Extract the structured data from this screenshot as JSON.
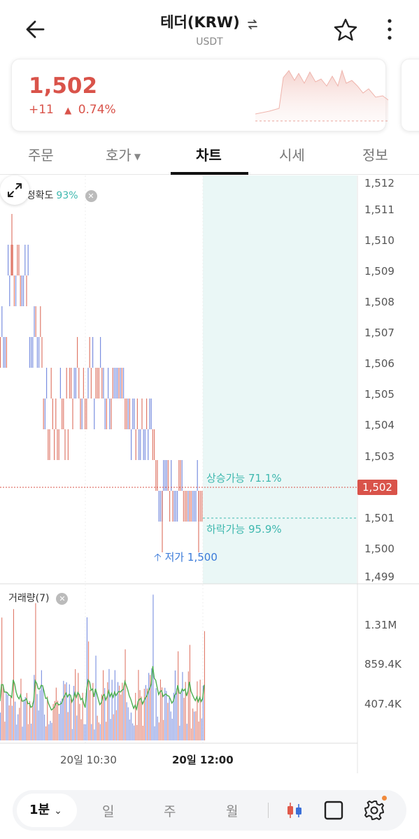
{
  "header": {
    "title": "테더(KRW)",
    "subtitle": "USDT",
    "swap_icon": "swap-arrows-icon",
    "back_icon": "arrow-left-icon",
    "favorite_icon": "star-outline-icon",
    "more_icon": "more-vertical-icon"
  },
  "price_card": {
    "price": "1,502",
    "change": "+11",
    "change_arrow": "▲",
    "change_pct": "0.74%",
    "color": "#d9534a"
  },
  "tabs": [
    {
      "label": "주문"
    },
    {
      "label": "호가"
    },
    {
      "label": "차트"
    },
    {
      "label": "시세"
    },
    {
      "label": "정보"
    }
  ],
  "active_tab": "차트",
  "chart": {
    "prediction_label": "예측정확도",
    "prediction_pct": "93%",
    "y_ticks": [
      "1,512",
      "1,511",
      "1,510",
      "1,509",
      "1,508",
      "1,507",
      "1,506",
      "1,505",
      "1,504",
      "1,503",
      "1,501",
      "1,500",
      "1,499"
    ],
    "current_price_tag": "1,502",
    "up_probability": "상승가능 71.1%",
    "down_probability": "하락가능 95.9%",
    "low_marker": "저가 1,500",
    "volume_label": "거래량(7)",
    "volume_ticks": [
      "1.31M",
      "859.4K",
      "407.4K"
    ],
    "x_ticks": [
      "20일 10:30",
      "20일 12:00"
    ],
    "up_color": "#e07a6a",
    "down_color": "#7a8fe0",
    "ma_color": "#4caf50",
    "forecast_color": "#eaf7f6"
  },
  "bottom_bar": {
    "interval": "1분",
    "periods": [
      "일",
      "주",
      "월"
    ],
    "icons": [
      "candlestick-icon",
      "square-icon",
      "settings-gear-icon"
    ]
  }
}
